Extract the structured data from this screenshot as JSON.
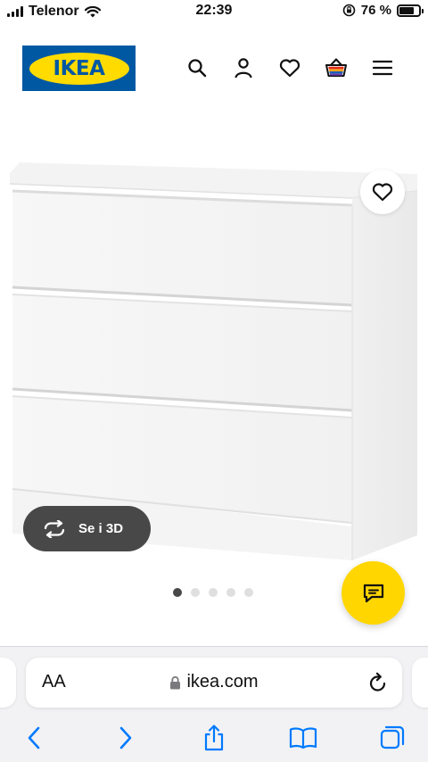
{
  "status_bar": {
    "carrier": "Telenor",
    "time": "22:39",
    "battery_percent": "76 %",
    "battery_level": 0.76
  },
  "header": {
    "logo_text": "IKEA",
    "icons": [
      "search-icon",
      "profile-icon",
      "favourites-icon",
      "cart-icon",
      "menu-icon"
    ]
  },
  "product": {
    "view_3d_label": "Se i 3D",
    "image_count": 5,
    "active_image_index": 0
  },
  "browser": {
    "text_size_label": "AA",
    "url": "ikea.com"
  },
  "colors": {
    "ikea_blue": "#0058a3",
    "ikea_yellow": "#ffdb00",
    "chat_yellow": "#ffd600",
    "safari_blue": "#007aff",
    "pill_dark": "#484848"
  }
}
